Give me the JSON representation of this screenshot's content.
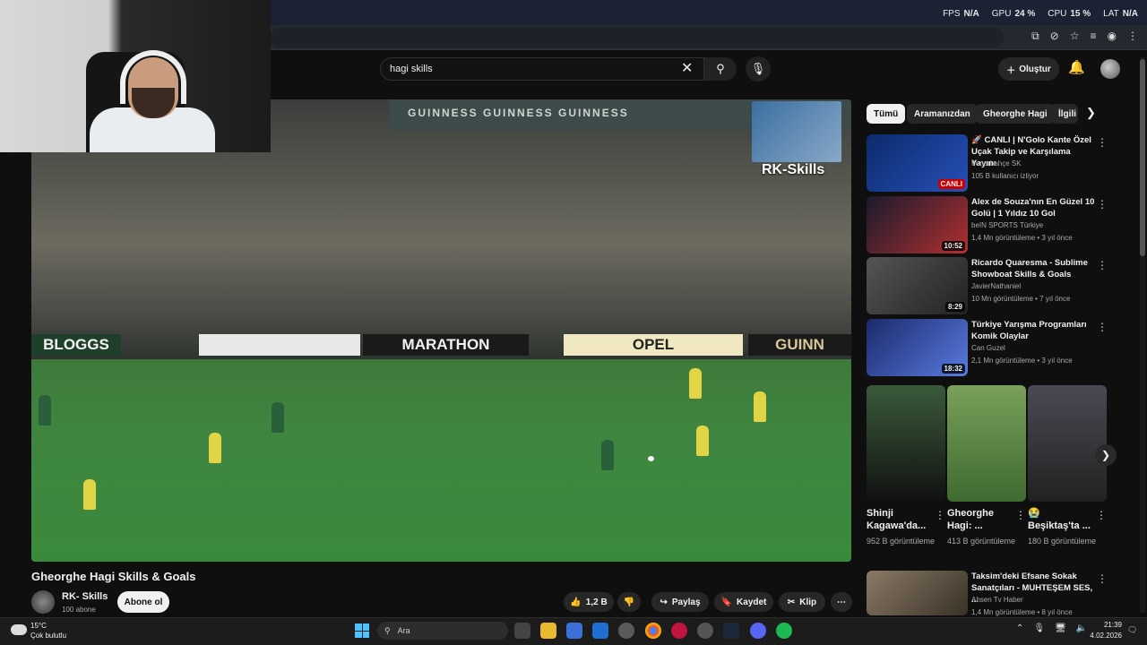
{
  "overlay_stats": [
    {
      "label": "FPS",
      "value": "N/A"
    },
    {
      "label": "GPU",
      "value": "24 %"
    },
    {
      "label": "CPU",
      "value": "15 %"
    },
    {
      "label": "LAT",
      "value": "N/A"
    }
  ],
  "header": {
    "search_value": "hagi skills",
    "create_label": "Oluştur"
  },
  "video": {
    "overlay_channel": "RK-Skills",
    "board_texts": [
      "BLOGGS",
      "MARATHON",
      "OPEL",
      "GUINN"
    ],
    "roof_text": "GUINNESS  GUINNESS  GUINNESS"
  },
  "watch": {
    "title": "Gheorghe Hagi Skills & Goals",
    "channel_name": "RK- Skills",
    "subscribers": "100 abone",
    "subscribe_label": "Abone ol",
    "likes": "1,2 B",
    "share_label": "Paylaş",
    "save_label": "Kaydet",
    "clip_label": "Klip"
  },
  "chips": [
    "Tümü",
    "Aramanızdan",
    "Gheorghe Hagi",
    "İlgili"
  ],
  "recommendations": [
    {
      "title": "🚀 CANLI | N'Golo Kante Özel Uçak Takip ve Karşılama Yayını",
      "channel": "Fenerbahçe SK",
      "meta": "105 B kullanıcı izliyor",
      "badge": "CANLI",
      "thumb_color": "#0b2b6b"
    },
    {
      "title": "Alex de Souza'nın En Güzel 10 Golü | 1 Yıldız 10 Gol",
      "channel": "beIN SPORTS Türkiye",
      "meta": "1,4 Mn görüntüleme • 3 yıl önce",
      "badge": "10:52",
      "thumb_color": "#1a1a2e"
    },
    {
      "title": "Ricardo Quaresma - Sublime Showboat Skills & Goals",
      "channel": "JavierNathaniel",
      "meta": "10 Mn görüntüleme • 7 yıl önce",
      "badge": "8:29",
      "thumb_color": "#3a3a3a"
    },
    {
      "title": "Türkiye Yarışma Programları Komik Olaylar",
      "channel": "Can Guzel",
      "meta": "2,1 Mn görüntüleme • 3 yıl önce",
      "badge": "18:32",
      "thumb_color": "#1b2a6b"
    },
    {
      "title": "Taksim'deki Efsane Sokak Sanatçıları - MUHTEŞEM SES, ...",
      "channel": "Ahsen Tv Haber",
      "meta": "1,4 Mn görüntüleme • 8 yıl önce",
      "badge": "",
      "thumb_color": "#6b5d4f"
    }
  ],
  "shorts": [
    {
      "title": "Shinji Kagawa'da...",
      "views": "952 B görüntüleme",
      "thumb_color": "#2d2d2d"
    },
    {
      "title": "Gheorghe Hagi: ...",
      "views": "413 B görüntüleme",
      "thumb_color": "#4f7a3a"
    },
    {
      "title": "😭 Beşiktaş'ta ...",
      "views": "180 B görüntüleme",
      "thumb_color": "#3a3a44"
    }
  ],
  "taskbar": {
    "temp": "15°C",
    "condition": "Çok bulutlu",
    "search_label": "Ara",
    "time": "21:39",
    "date": "4.02.2026"
  }
}
